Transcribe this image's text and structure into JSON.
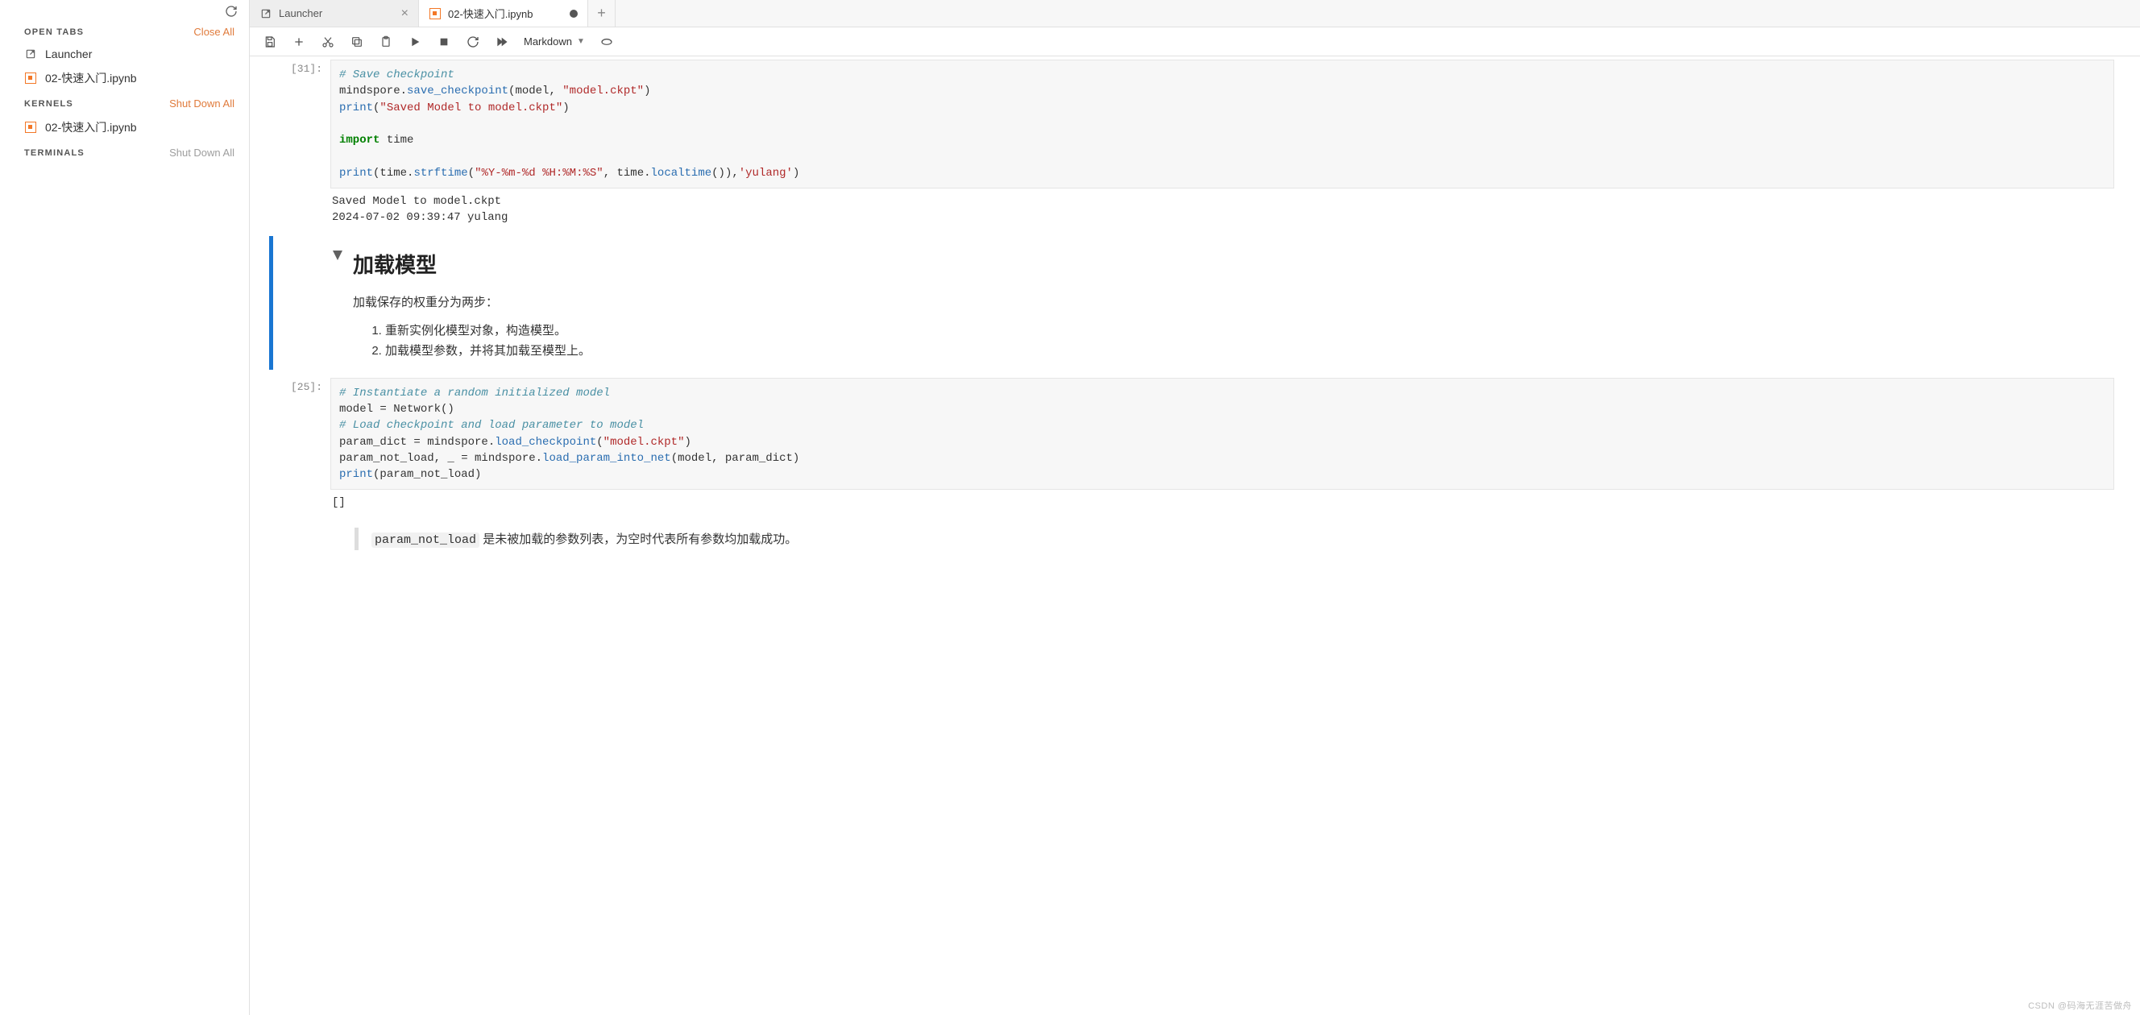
{
  "sidebar": {
    "open_tabs_label": "OPEN TABS",
    "close_all": "Close All",
    "kernels_label": "KERNELS",
    "shut_down_all": "Shut Down All",
    "terminals_label": "TERMINALS",
    "terminals_action": "Shut Down All",
    "items": {
      "launcher": "Launcher",
      "notebook": "02-快速入门.ipynb",
      "kernel_notebook": "02-快速入门.ipynb"
    }
  },
  "tabs": {
    "launcher": "Launcher",
    "notebook": "02-快速入门.ipynb"
  },
  "toolbar": {
    "cell_type": "Markdown"
  },
  "cells": {
    "c31": {
      "prompt": "[31]:",
      "output": "Saved Model to model.ckpt\n2024-07-02 09:39:47 yulang"
    },
    "md1": {
      "heading": "加载模型",
      "para": "加载保存的权重分为两步：",
      "li1": "重新实例化模型对象，构造模型。",
      "li2": "加载模型参数，并将其加载至模型上。"
    },
    "c25": {
      "prompt": "[25]:",
      "output": "[]"
    },
    "note": {
      "code": "param_not_load",
      "text": " 是未被加载的参数列表，为空时代表所有参数均加载成功。"
    }
  },
  "watermark": "CSDN @码海无涯苦做舟"
}
